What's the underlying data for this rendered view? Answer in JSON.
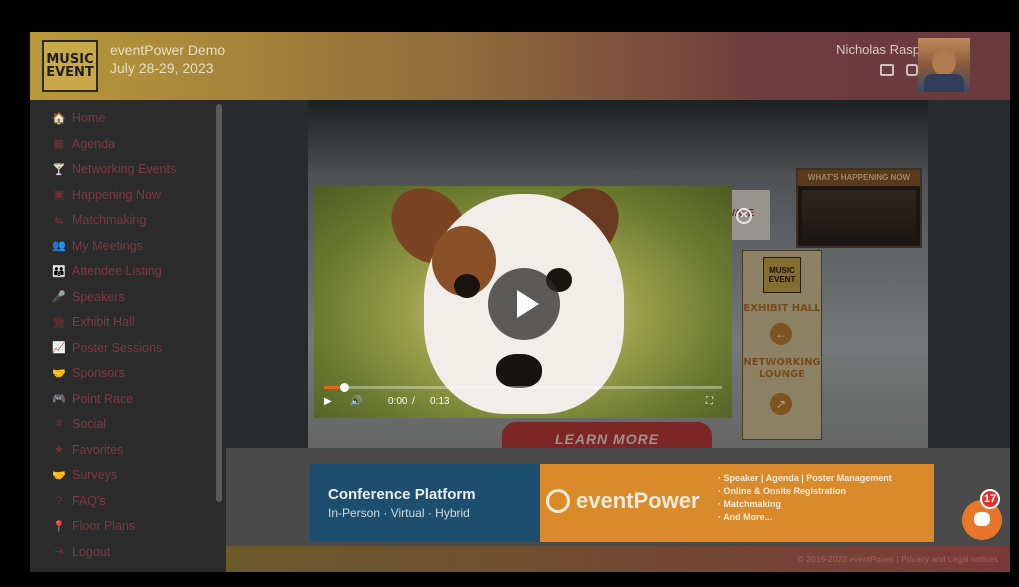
{
  "header": {
    "logo_line1": "MUSIC",
    "logo_line2": "EVENT",
    "event_title": "eventPower Demo",
    "event_dates": "July 28-29, 2023",
    "user_name": "Nicholas Rasp",
    "icons": [
      "id-card-icon",
      "copy-icon"
    ]
  },
  "sidebar": {
    "items": [
      {
        "label": "Home",
        "icon": "home-icon",
        "glyph": "🏠"
      },
      {
        "label": "Agenda",
        "icon": "calendar-icon",
        "glyph": "▦"
      },
      {
        "label": "Networking Events",
        "icon": "glass-icon",
        "glyph": "🍸"
      },
      {
        "label": "Happening Now",
        "icon": "calendar-check-icon",
        "glyph": "▣"
      },
      {
        "label": "Matchmaking",
        "icon": "match-icon",
        "glyph": "⇆"
      },
      {
        "label": "My Meetings",
        "icon": "users-icon",
        "glyph": "👥"
      },
      {
        "label": "Attendee Listing",
        "icon": "group-icon",
        "glyph": "👪"
      },
      {
        "label": "Speakers",
        "icon": "speaker-icon",
        "glyph": "🎤"
      },
      {
        "label": "Exhibit Hall",
        "icon": "building-icon",
        "glyph": "🏛"
      },
      {
        "label": "Poster Sessions",
        "icon": "chart-icon",
        "glyph": "📈"
      },
      {
        "label": "Sponsors",
        "icon": "handshake-icon",
        "glyph": "🤝"
      },
      {
        "label": "Point Race",
        "icon": "gamepad-icon",
        "glyph": "🎮"
      },
      {
        "label": "Social",
        "icon": "hashtag-icon",
        "glyph": "#"
      },
      {
        "label": "Favorites",
        "icon": "star-icon",
        "glyph": "★"
      },
      {
        "label": "Surveys",
        "icon": "survey-icon",
        "glyph": "🤝"
      },
      {
        "label": "FAQ's",
        "icon": "question-icon",
        "glyph": "?"
      },
      {
        "label": "Floor Plans",
        "icon": "map-pin-icon",
        "glyph": "📍"
      },
      {
        "label": "Logout",
        "icon": "logout-icon",
        "glyph": "⇥"
      }
    ]
  },
  "scene": {
    "banner_label": "WHAT'S HAPPENING NOW",
    "booth_brand": "WAVE",
    "sign_logo_line1": "MUSIC",
    "sign_logo_line2": "EVENT",
    "sign_exhibit": "EXHIBIT HALL",
    "sign_networking_1": "NETWORKING",
    "sign_networking_2": "LOUNGE",
    "learn_more": "LEARN MORE"
  },
  "video": {
    "current_time": "0:00",
    "separator": "/",
    "duration": "0:13",
    "progress": 0.05,
    "close_glyph": "✕"
  },
  "ad": {
    "title": "Conference Platform",
    "subtitle": "In-Person · Virtual · Hybrid",
    "brand": "eventPower",
    "bullets": [
      "· Speaker | Agenda | Poster Management",
      "· Online & Onsite Registration",
      "· Matchmaking",
      "· And More..."
    ]
  },
  "footer": {
    "text": "© 2016-2023 eventPower | Privacy and Legal notices"
  },
  "chat": {
    "badge": "17"
  },
  "colors": {
    "accent": "#e8762a",
    "sidebar_text": "#7b3a44",
    "ad_blue": "#1d4e6e",
    "ad_orange": "#d98a2a"
  }
}
